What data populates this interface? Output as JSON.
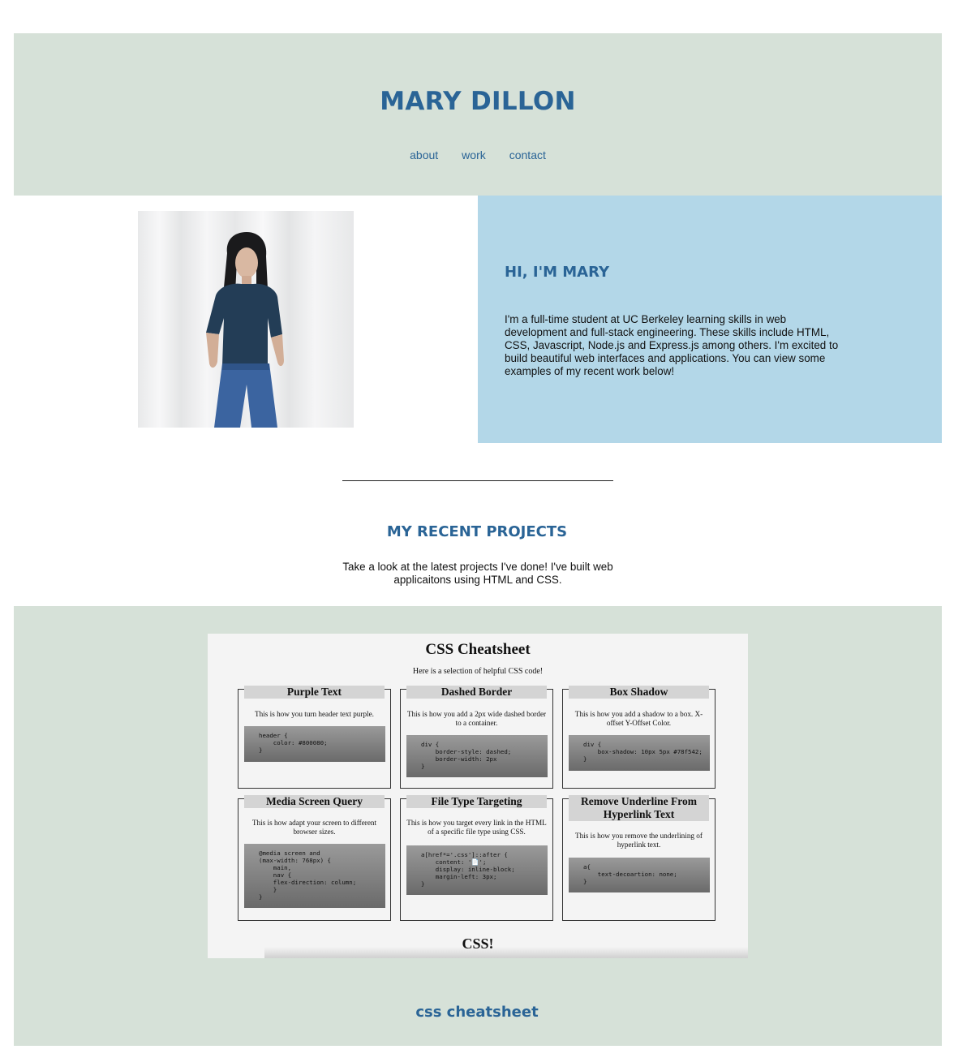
{
  "header": {
    "title": "MARY DILLON",
    "nav": [
      "about",
      "work",
      "contact"
    ]
  },
  "about": {
    "photo_alt": "portrait of Mary Dillon",
    "heading": "HI, I'M MARY",
    "text": "I'm a full-time student at UC Berkeley learning skills in web development and full-stack engineering. These skills include HTML, CSS, Javascript, Node.js and Express.js among others. I'm excited to build beautiful web interfaces and applications. You can view some examples of my recent work below!"
  },
  "projects": {
    "heading": "MY RECENT PROJECTS",
    "text": "Take a look at the latest projects I've done! I've built web applicaitons using HTML and CSS.",
    "items": [
      {
        "link_label": "css cheatsheet",
        "screenshot": {
          "title": "CSS Cheatsheet",
          "subtitle": "Here is a selection of helpful CSS code!",
          "footer": "CSS!",
          "cards": [
            {
              "title": "Purple Text",
              "desc": "This is how you turn header text purple.",
              "code": "header {\n    color: #800080;\n}"
            },
            {
              "title": "Dashed Border",
              "desc": "This is how you add a 2px wide dashed border to a container.",
              "code": "div {\n    border-style: dashed;\n    border-width: 2px\n}"
            },
            {
              "title": "Box Shadow",
              "desc": "This is how you add a shadow to a box. X-offset Y-Offset Color.",
              "code": "div {\n    box-shadow: 10px 5px #78f542;\n}"
            },
            {
              "title": "Media Screen Query",
              "desc": "This is how adapt your screen to different browser sizes.",
              "code": "@media screen and\n(max-width: 768px) {\n    main,\n    nav {\n    flex-direction: column;\n    }\n}"
            },
            {
              "title": "File Type Targeting",
              "desc": "This is how you target every link in the HTML of a specific file type using CSS.",
              "code": "a[href*='.css']::after {\n    content: '📄';\n    display: inline-block;\n    margin-left: 3px;\n}"
            },
            {
              "title": "Remove Underline From Hyperlink Text",
              "desc": "This is how you remove the underlining of hyperlink text.",
              "code": "a{\n    text-decoartion: none;\n}"
            }
          ]
        }
      }
    ]
  },
  "colors": {
    "band": "#d6e1d8",
    "accent": "#2a6496",
    "about_panel": "#b3d7e8"
  }
}
